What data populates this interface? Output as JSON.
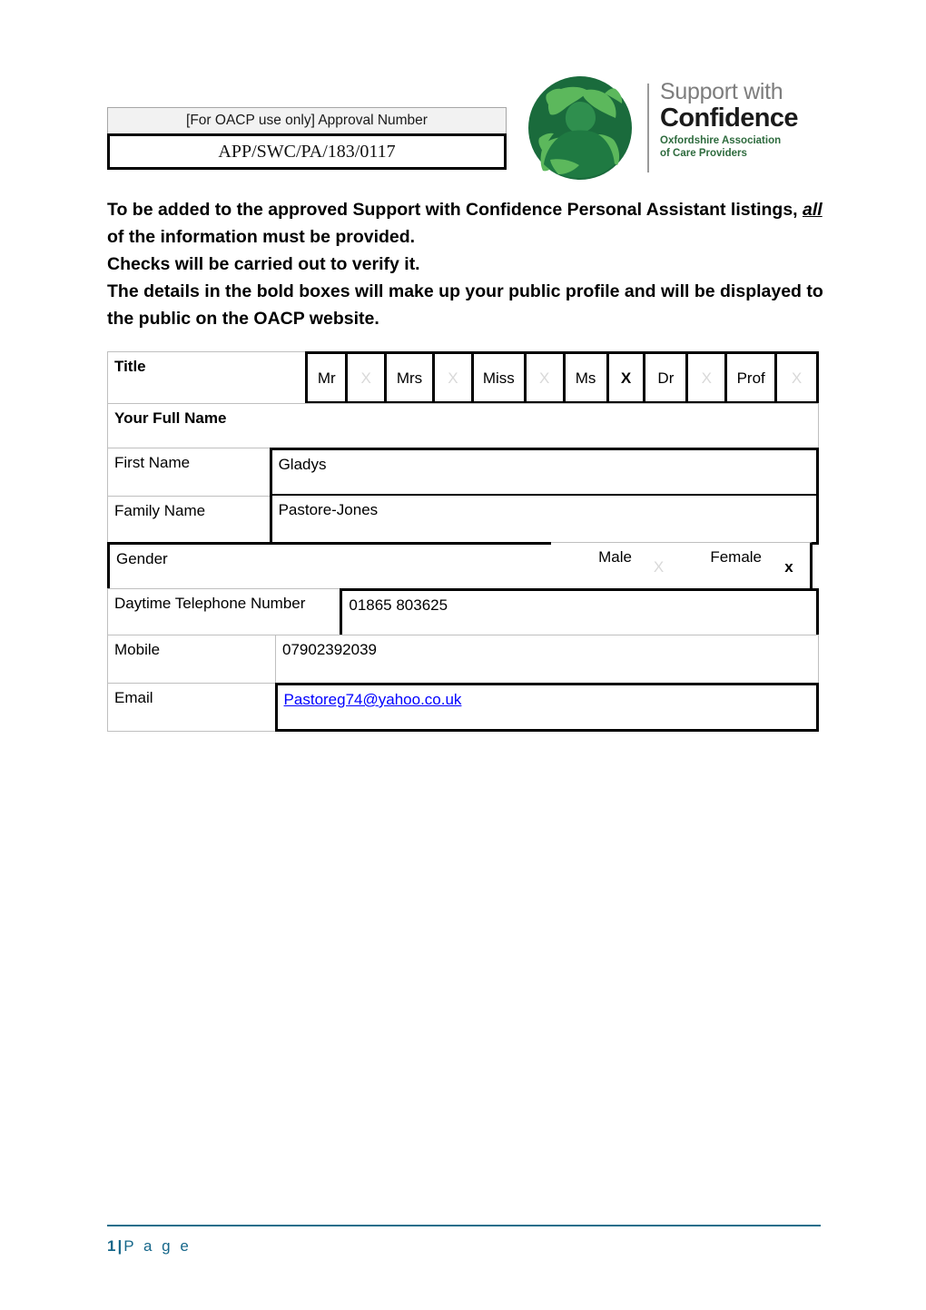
{
  "header": {
    "approval_label": "[For OACP use only] Approval Number",
    "approval_number": "APP/SWC/PA/183/0117",
    "logo": {
      "line1": "Support with",
      "line2": "Confidence",
      "sub_line1": "Oxfordshire Association",
      "sub_line2": "of Care Providers",
      "mark_circle_color": "#1a6b3c",
      "mark_hand_color": "#5cb85c",
      "line1_color": "#7d7d7d",
      "line2_color": "#1a1a1a",
      "sub_color": "#2e6b3e"
    }
  },
  "intro": {
    "line1_a": "To be added to the approved Support with Confidence Personal Assistant listings, ",
    "line1_em": "all",
    "line1_b": " of the information must be provided.",
    "line2": "Checks will be carried out to verify it.",
    "line3": "The details in the bold boxes will make up your public profile and will be displayed to the public on the OACP website."
  },
  "form": {
    "title": {
      "label": "Title",
      "options": [
        {
          "label": "Mr",
          "mark": "X",
          "selected": false
        },
        {
          "label": "Mrs",
          "mark": "X",
          "selected": false
        },
        {
          "label": "Miss",
          "mark": "X",
          "selected": false
        },
        {
          "label": "Ms",
          "mark": "X",
          "selected": true
        },
        {
          "label": "Dr",
          "mark": "X",
          "selected": false
        },
        {
          "label": "Prof",
          "mark": "X",
          "selected": false
        }
      ]
    },
    "full_name_header": "Your Full Name",
    "first_name": {
      "label": "First Name",
      "value": "Gladys"
    },
    "family_name": {
      "label": "Family Name",
      "value": "Pastore-Jones"
    },
    "gender": {
      "label": "Gender",
      "male_label": "Male",
      "male_mark": "X",
      "male_selected": false,
      "female_label": "Female",
      "female_mark": "x",
      "female_selected": true
    },
    "daytime_phone": {
      "label": "Daytime Telephone Number",
      "value": "01865 803625"
    },
    "mobile": {
      "label": "Mobile",
      "value": "07902392039"
    },
    "email": {
      "label": "Email",
      "value": "Pastoreg74@yahoo.co.uk",
      "link_color": "#0000ff"
    }
  },
  "footer": {
    "page_number": "1",
    "separator": "|",
    "page_word": "P a g e",
    "color": "#16678a"
  }
}
